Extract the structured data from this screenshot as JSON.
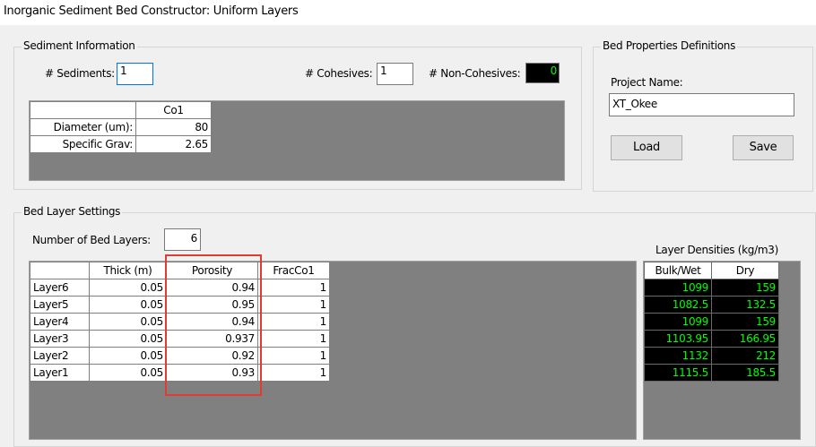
{
  "window": {
    "title": "Inorganic Sediment Bed Constructor: Uniform Layers"
  },
  "sediment_info": {
    "legend": "Sediment Information",
    "num_sediments_label": "# Sediments:",
    "num_sediments_value": "1",
    "num_cohesives_label": "# Cohesives:",
    "num_cohesives_value": "1",
    "num_noncohesives_label": "# Non-Cohesives:",
    "num_noncohesives_value": "0",
    "grid": {
      "col_header": "Co1",
      "rows": [
        {
          "label": "Diameter (um):",
          "value": "80"
        },
        {
          "label": "Specific Grav:",
          "value": "2.65"
        }
      ]
    }
  },
  "bed_props": {
    "legend": "Bed Properties Definitions",
    "project_label": "Project Name:",
    "project_value": "XT_Okee",
    "load_label": "Load",
    "save_label": "Save"
  },
  "bed_layers": {
    "legend": "Bed Layer Settings",
    "num_layers_label": "Number of Bed Layers:",
    "num_layers_value": "6",
    "columns": [
      "Thick (m)",
      "Porosity",
      "FracCo1"
    ],
    "rows": [
      {
        "name": "Layer6",
        "thick": "0.05",
        "porosity": "0.94",
        "frac": "1"
      },
      {
        "name": "Layer5",
        "thick": "0.05",
        "porosity": "0.95",
        "frac": "1"
      },
      {
        "name": "Layer4",
        "thick": "0.05",
        "porosity": "0.94",
        "frac": "1"
      },
      {
        "name": "Layer3",
        "thick": "0.05",
        "porosity": "0.937",
        "frac": "1"
      },
      {
        "name": "Layer2",
        "thick": "0.05",
        "porosity": "0.92",
        "frac": "1"
      },
      {
        "name": "Layer1",
        "thick": "0.05",
        "porosity": "0.93",
        "frac": "1"
      }
    ],
    "densities_label": "Layer Densities (kg/m3)",
    "density_columns": [
      "Bulk/Wet",
      "Dry"
    ],
    "densities": [
      {
        "bulk": "1099",
        "dry": "159"
      },
      {
        "bulk": "1082.5",
        "dry": "132.5"
      },
      {
        "bulk": "1099",
        "dry": "159"
      },
      {
        "bulk": "1103.95",
        "dry": "166.95"
      },
      {
        "bulk": "1132",
        "dry": "212"
      },
      {
        "bulk": "1115.5",
        "dry": "185.5"
      }
    ]
  },
  "colors": {
    "highlight": "#e03c31",
    "density_text": "#00ff00",
    "grid_bg": "#808080"
  }
}
